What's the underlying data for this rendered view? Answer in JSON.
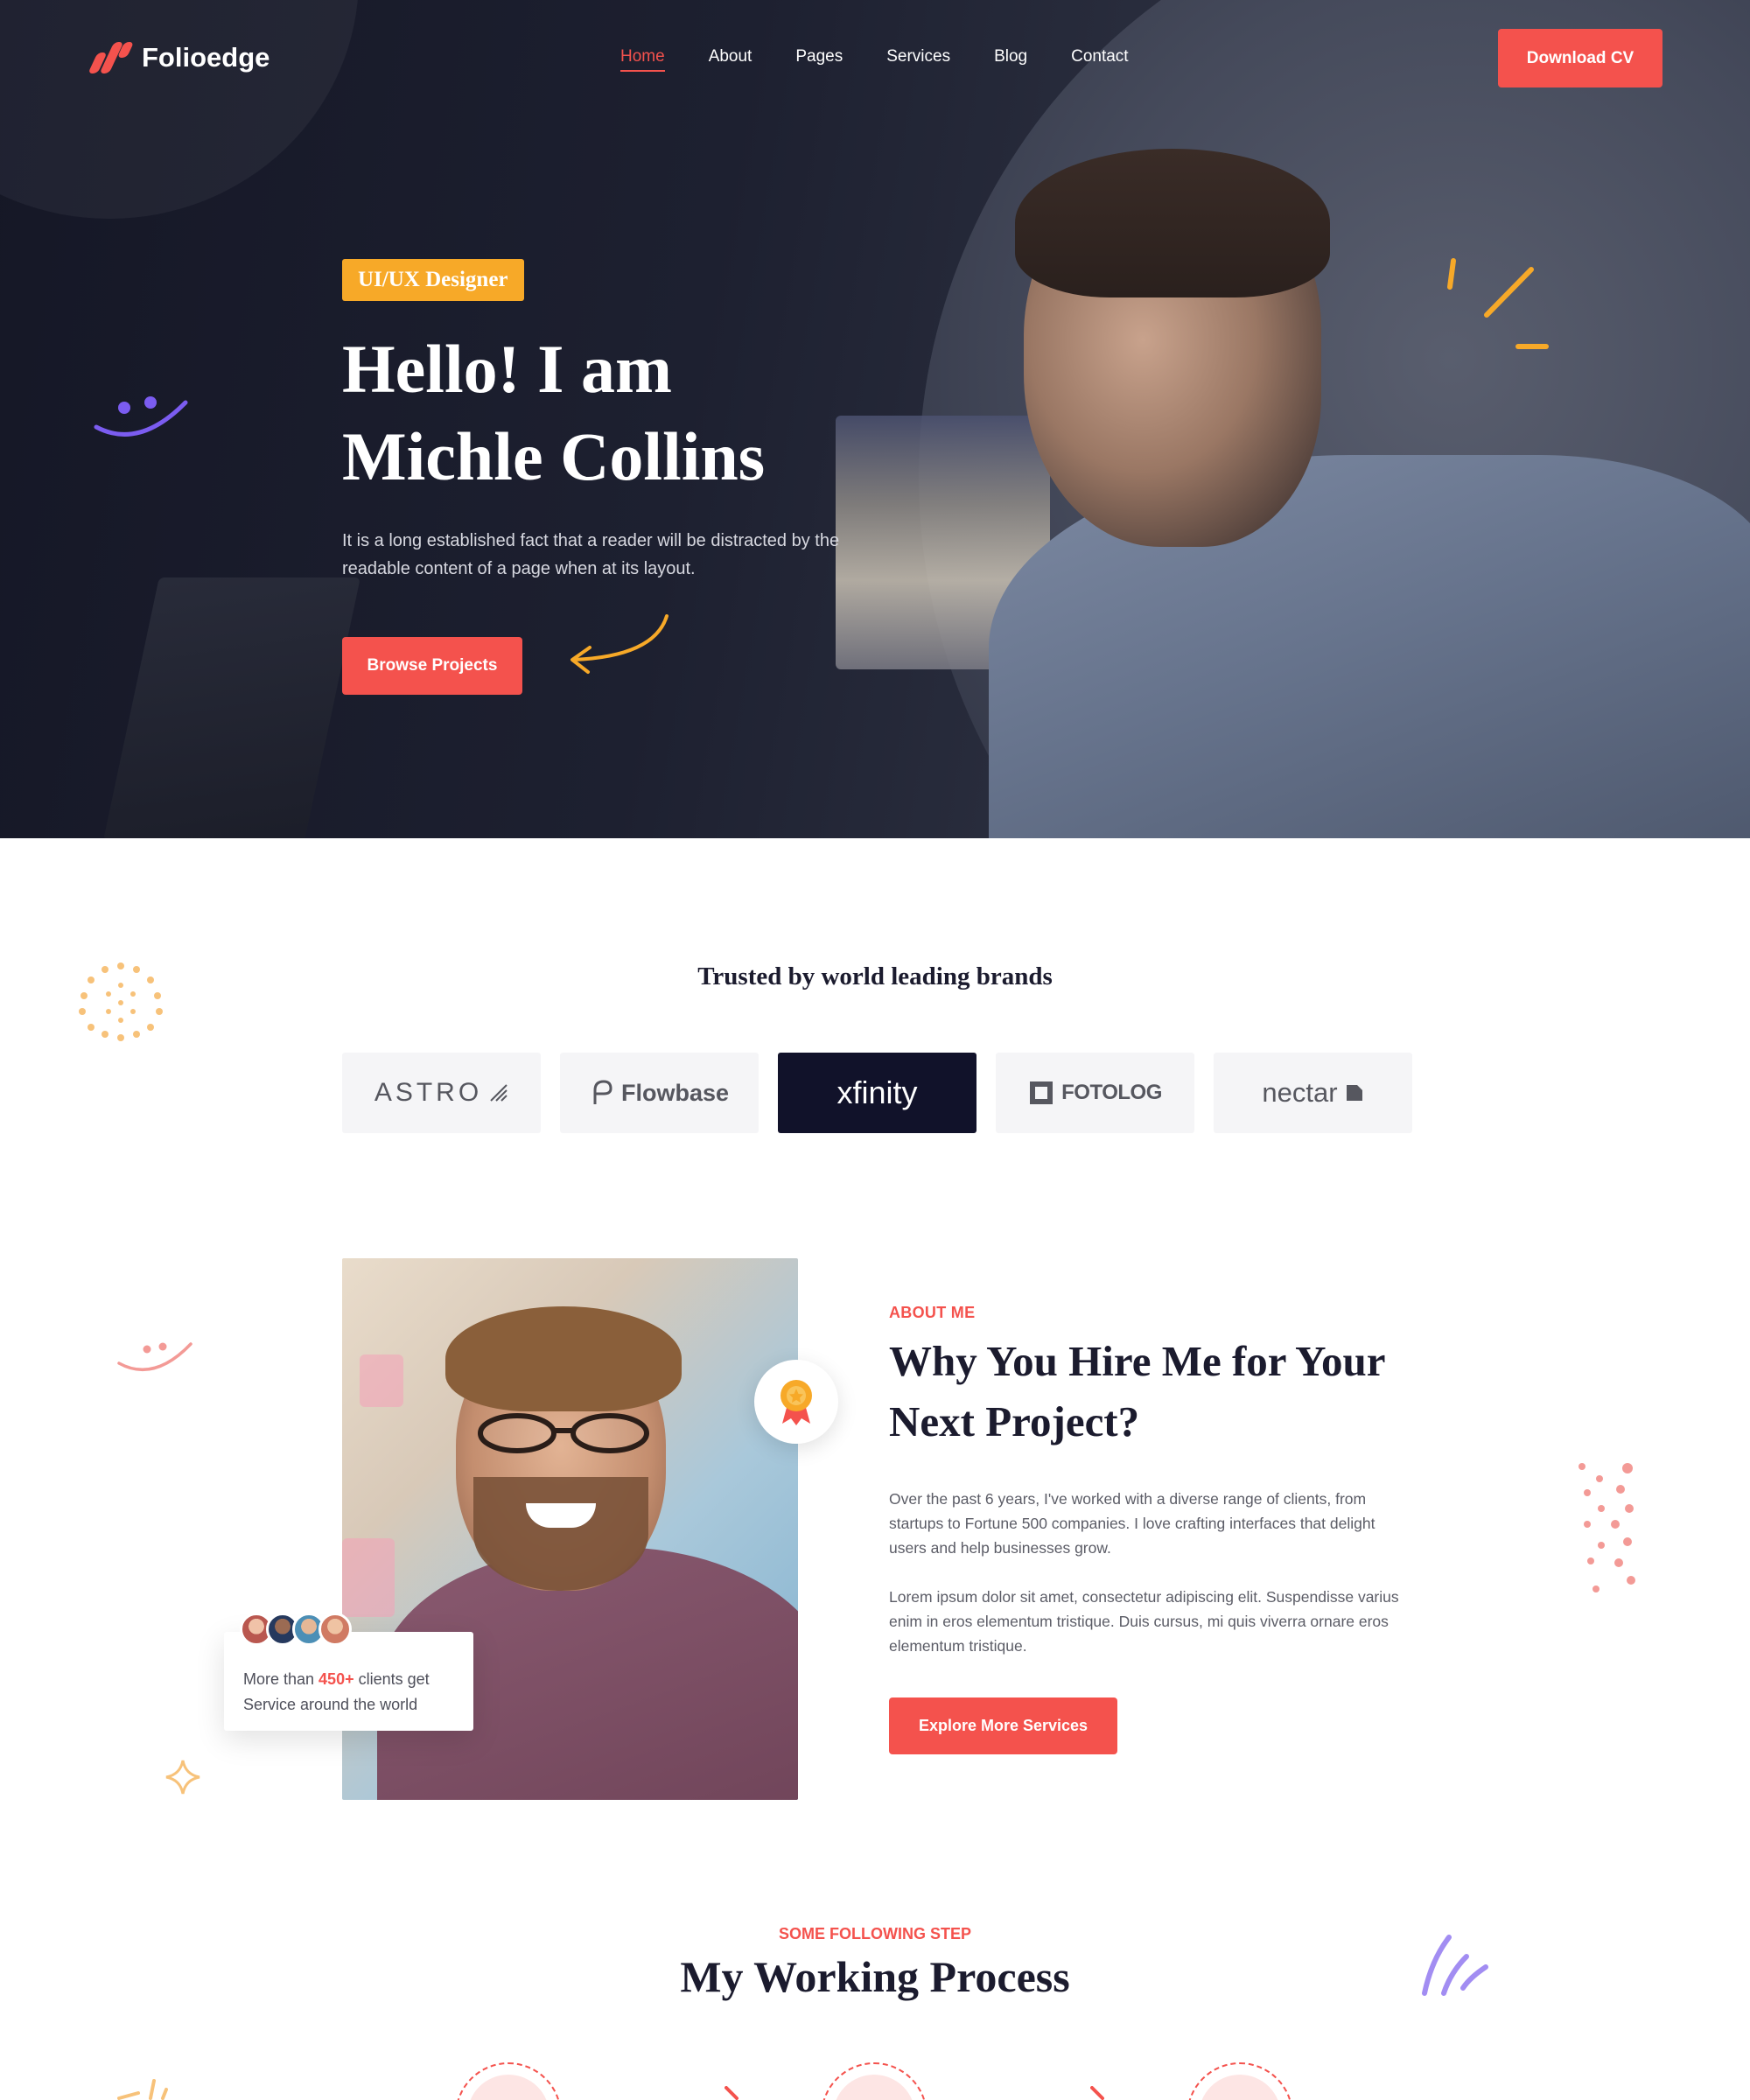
{
  "nav": {
    "brand": "Folioedge",
    "items": [
      {
        "label": "Home",
        "active": true
      },
      {
        "label": "About",
        "active": false
      },
      {
        "label": "Pages",
        "active": false
      },
      {
        "label": "Services",
        "active": false
      },
      {
        "label": "Blog",
        "active": false
      },
      {
        "label": "Contact",
        "active": false
      }
    ],
    "cta": "Download CV"
  },
  "hero": {
    "tag": "UI/UX Designer",
    "title_line1": "Hello! I am",
    "title_line2": "Michle Collins",
    "description": "It is a long established fact that a reader will be distracted by the readable content of a page when at its layout.",
    "button": "Browse Projects"
  },
  "brands": {
    "title": "Trusted by world leading brands",
    "logos": [
      "ASTRO",
      "Flowbase",
      "xfinity",
      "FOTOLOG",
      "nectar"
    ]
  },
  "about": {
    "eyebrow": "ABOUT ME",
    "title_line1": "Why You Hire Me for Your",
    "title_line2": "Next Project?",
    "paragraph1": "Over the past 6 years, I've worked with a diverse range of clients, from startups to Fortune 500 companies. I love crafting interfaces that delight users and help businesses grow.",
    "paragraph2": "Lorem ipsum dolor sit amet, consectetur adipiscing elit. Suspendisse varius enim in eros elementum tristique. Duis cursus, mi quis viverra ornare eros elementum tristique.",
    "button": "Explore More Services",
    "clients_prefix": "More than ",
    "clients_count": "450+",
    "clients_suffix": " clients get",
    "clients_line2": "Service around the world"
  },
  "process": {
    "eyebrow": "SOME FOLLOWING STEP",
    "title": "My Working Process"
  },
  "colors": {
    "accent": "#f4524d",
    "tag": "#f7a928",
    "dark": "#11122a"
  }
}
